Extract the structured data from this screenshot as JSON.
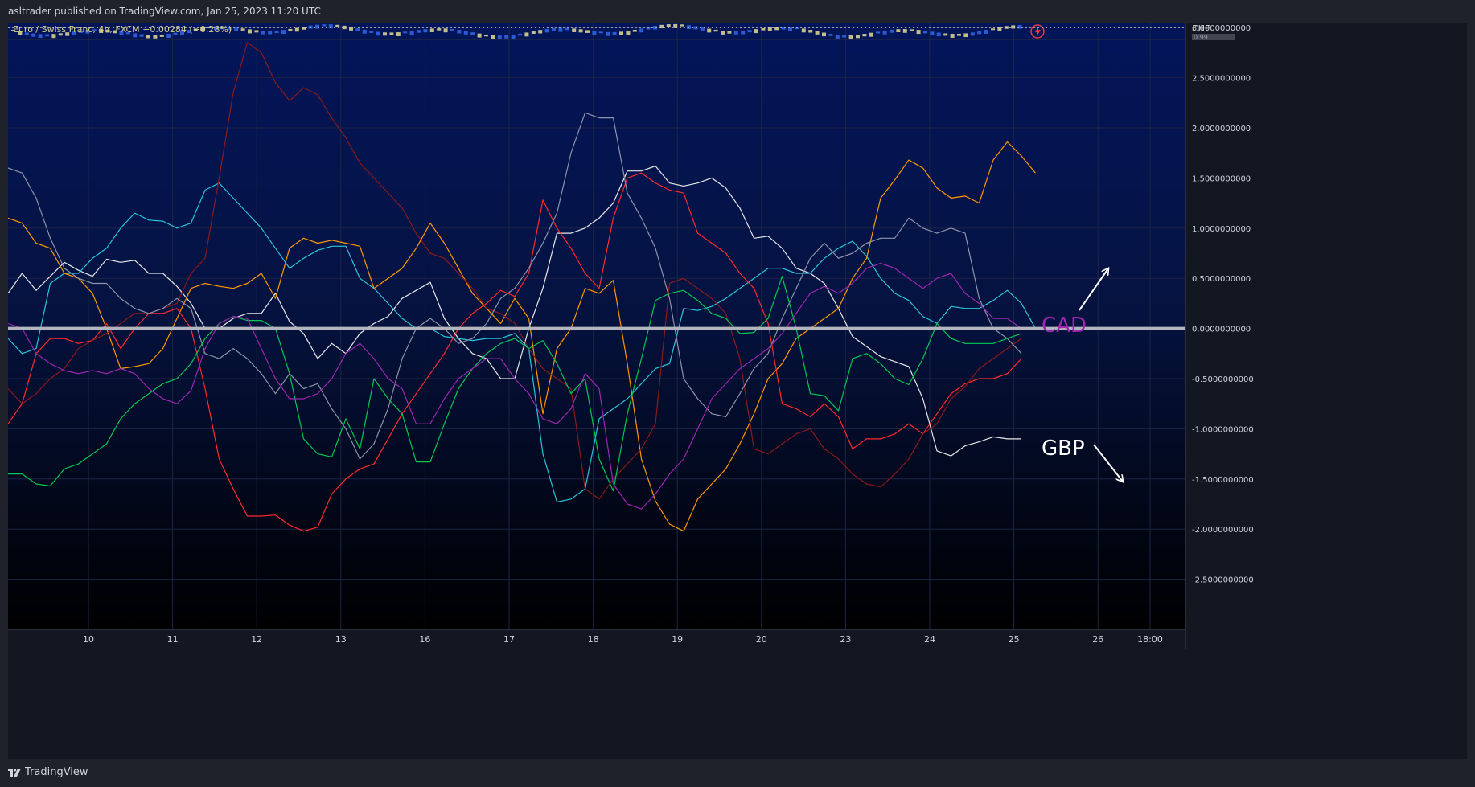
{
  "header": {
    "published": "asltrader published on TradingView.com, Jan 25, 2023 11:20 UTC"
  },
  "footer": {
    "brand": "TradingView"
  },
  "colors": {
    "background_top": "#03155a",
    "background_bottom": "#000000",
    "grid": "#1d2545",
    "axis_text": "#d1d4dc",
    "zero_line": "#b2b5be",
    "price_up": "#d8cf8f",
    "price_down": "#2f63e0"
  },
  "chart_data": {
    "type": "line",
    "symbol_legend": "Euro / Swiss Franc, 4h, FXCM  −0.00284 (−0.28%)",
    "currency_label": "CHF",
    "price_label_partial": "0.99",
    "x_ticks": [
      "10",
      "11",
      "12",
      "13",
      "16",
      "17",
      "18",
      "19",
      "20",
      "23",
      "24",
      "25",
      "26",
      "18:00"
    ],
    "ylim": [
      -3.0,
      3.05
    ],
    "y_ticks": [
      "3.0000000000",
      "2.5000000000",
      "2.0000000000",
      "1.5000000000",
      "1.0000000000",
      "0.5000000000",
      "0.0000000000",
      "-0.5000000000",
      "-1.0000000000",
      "-1.5000000000",
      "-2.0000000000",
      "-2.5000000000"
    ],
    "zero_line": 0,
    "dotted_line": 3.0,
    "annotations": [
      {
        "text": "CAD",
        "color": "#9c27b0"
      },
      {
        "text": "GBP",
        "color": "#ffffff"
      }
    ],
    "series": [
      {
        "color": "#e8e8e8",
        "values": [
          0.35,
          0.55,
          0.38,
          0.52,
          0.66,
          0.58,
          0.52,
          0.69,
          0.66,
          0.68,
          0.55,
          0.55,
          0.42,
          0.25,
          0.0,
          0.0,
          0.1,
          0.15,
          0.15,
          0.35,
          0.07,
          -0.05,
          -0.3,
          -0.15,
          -0.25,
          -0.05,
          0.05,
          0.12,
          0.3,
          0.38,
          0.46,
          0.1,
          -0.1,
          -0.25,
          -0.3,
          -0.5,
          -0.5,
          0.0,
          0.4,
          0.95,
          0.95,
          1.0,
          1.1,
          1.25,
          1.57,
          1.57,
          1.62,
          1.45,
          1.42,
          1.45,
          1.5,
          1.4,
          1.2,
          0.9,
          0.92,
          0.8,
          0.6,
          0.55,
          0.45,
          0.2,
          -0.08,
          -0.18,
          -0.28,
          -0.33,
          -0.38,
          -0.7,
          -1.22,
          -1.27,
          -1.17,
          -1.13,
          -1.08,
          -1.1,
          -1.1
        ]
      },
      {
        "color": "#26c6da",
        "values": [
          -0.1,
          -0.25,
          -0.2,
          0.45,
          0.55,
          0.55,
          0.7,
          0.8,
          1.0,
          1.15,
          1.08,
          1.07,
          1.0,
          1.05,
          1.38,
          1.45,
          1.3,
          1.15,
          1.0,
          0.8,
          0.6,
          0.7,
          0.78,
          0.82,
          0.82,
          0.5,
          0.4,
          0.25,
          0.1,
          0.0,
          0.0,
          -0.08,
          -0.1,
          -0.12,
          -0.1,
          -0.1,
          -0.05,
          -0.2,
          -1.25,
          -1.73,
          -1.7,
          -1.6,
          -0.9,
          -0.8,
          -0.7,
          -0.55,
          -0.4,
          -0.35,
          0.2,
          0.18,
          0.22,
          0.3,
          0.4,
          0.5,
          0.6,
          0.6,
          0.55,
          0.55,
          0.7,
          0.8,
          0.87,
          0.72,
          0.5,
          0.35,
          0.28,
          0.12,
          0.05,
          0.22,
          0.2,
          0.2,
          0.28,
          0.38,
          0.25,
          0.0
        ]
      },
      {
        "color": "#ff9800",
        "values": [
          1.1,
          1.05,
          0.85,
          0.8,
          0.55,
          0.5,
          0.35,
          0.0,
          -0.4,
          -0.38,
          -0.35,
          -0.2,
          0.1,
          0.4,
          0.45,
          0.42,
          0.4,
          0.45,
          0.55,
          0.3,
          0.8,
          0.9,
          0.85,
          0.88,
          0.85,
          0.82,
          0.4,
          0.5,
          0.6,
          0.8,
          1.05,
          0.85,
          0.6,
          0.35,
          0.2,
          0.05,
          0.3,
          0.1,
          -0.85,
          -0.2,
          0.0,
          0.4,
          0.35,
          0.48,
          -0.35,
          -1.3,
          -1.72,
          -1.95,
          -2.02,
          -1.7,
          -1.55,
          -1.4,
          -1.15,
          -0.85,
          -0.5,
          -0.35,
          -0.1,
          0.0,
          0.1,
          0.2,
          0.5,
          0.7,
          1.3,
          1.48,
          1.68,
          1.6,
          1.4,
          1.3,
          1.32,
          1.25,
          1.68,
          1.86,
          1.72,
          1.55
        ]
      },
      {
        "color": "#ff2a2a",
        "values": [
          -0.95,
          -0.75,
          -0.25,
          -0.1,
          -0.1,
          -0.15,
          -0.12,
          0.05,
          -0.2,
          0.0,
          0.15,
          0.15,
          0.2,
          0.0,
          -0.6,
          -1.3,
          -1.6,
          -1.87,
          -1.87,
          -1.86,
          -1.96,
          -2.02,
          -1.98,
          -1.65,
          -1.5,
          -1.4,
          -1.35,
          -1.1,
          -0.85,
          -0.65,
          -0.45,
          -0.25,
          0.0,
          0.15,
          0.25,
          0.38,
          0.32,
          0.55,
          1.28,
          1.0,
          0.8,
          0.55,
          0.4,
          1.1,
          1.5,
          1.55,
          1.45,
          1.38,
          1.35,
          0.95,
          0.85,
          0.75,
          0.55,
          0.4,
          0.05,
          -0.75,
          -0.8,
          -0.88,
          -0.75,
          -0.88,
          -1.2,
          -1.1,
          -1.1,
          -1.05,
          -0.95,
          -1.05,
          -0.85,
          -0.65,
          -0.55,
          -0.5,
          -0.5,
          -0.45,
          -0.3
        ]
      },
      {
        "color": "#8b1a1a",
        "values": [
          -0.6,
          -0.75,
          -0.65,
          -0.5,
          -0.4,
          -0.2,
          -0.12,
          -0.05,
          0.05,
          0.15,
          0.15,
          0.2,
          0.25,
          0.55,
          0.7,
          1.5,
          2.35,
          2.85,
          2.75,
          2.45,
          2.27,
          2.4,
          2.33,
          2.1,
          1.9,
          1.65,
          1.5,
          1.35,
          1.2,
          0.95,
          0.75,
          0.7,
          0.55,
          0.4,
          0.2,
          0.15,
          0.05,
          -0.2,
          -0.4,
          -0.5,
          -0.6,
          -1.6,
          -1.7,
          -1.5,
          -1.35,
          -1.2,
          -0.95,
          0.45,
          0.5,
          0.4,
          0.3,
          0.15,
          -0.3,
          -1.2,
          -1.25,
          -1.15,
          -1.05,
          -1.0,
          -1.2,
          -1.3,
          -1.45,
          -1.55,
          -1.58,
          -1.45,
          -1.3,
          -1.05,
          -0.95,
          -0.7,
          -0.58,
          -0.4,
          -0.3,
          -0.2,
          -0.1
        ]
      },
      {
        "color": "#8d93a8",
        "values": [
          1.6,
          1.55,
          1.3,
          0.9,
          0.6,
          0.5,
          0.45,
          0.45,
          0.3,
          0.2,
          0.15,
          0.2,
          0.3,
          0.2,
          -0.25,
          -0.3,
          -0.2,
          -0.3,
          -0.45,
          -0.65,
          -0.45,
          -0.6,
          -0.55,
          -0.8,
          -1.0,
          -1.3,
          -1.15,
          -0.8,
          -0.3,
          0.0,
          0.1,
          0.0,
          -0.15,
          -0.1,
          0.05,
          0.3,
          0.4,
          0.6,
          0.85,
          1.15,
          1.75,
          2.15,
          2.1,
          2.1,
          1.35,
          1.1,
          0.8,
          0.3,
          -0.5,
          -0.7,
          -0.85,
          -0.88,
          -0.65,
          -0.4,
          -0.25,
          0.1,
          0.4,
          0.7,
          0.85,
          0.7,
          0.75,
          0.85,
          0.9,
          0.9,
          1.1,
          1.0,
          0.95,
          1.0,
          0.95,
          0.3,
          0.0,
          -0.1,
          -0.25
        ]
      },
      {
        "color": "#00c853",
        "values": [
          -1.45,
          -1.45,
          -1.55,
          -1.57,
          -1.4,
          -1.35,
          -1.25,
          -1.15,
          -0.9,
          -0.75,
          -0.65,
          -0.55,
          -0.5,
          -0.35,
          -0.1,
          0.05,
          0.12,
          0.08,
          0.08,
          0.0,
          -0.45,
          -1.1,
          -1.25,
          -1.28,
          -0.9,
          -1.2,
          -0.5,
          -0.7,
          -0.85,
          -1.33,
          -1.33,
          -0.95,
          -0.6,
          -0.4,
          -0.25,
          -0.15,
          -0.1,
          -0.2,
          -0.12,
          -0.35,
          -0.65,
          -0.5,
          -1.3,
          -1.62,
          -0.85,
          -0.3,
          0.28,
          0.35,
          0.38,
          0.28,
          0.15,
          0.1,
          -0.05,
          -0.04,
          0.1,
          0.52,
          0.0,
          -0.65,
          -0.67,
          -0.82,
          -0.3,
          -0.25,
          -0.35,
          -0.5,
          -0.56,
          -0.3,
          0.05,
          -0.1,
          -0.15,
          -0.15,
          -0.15,
          -0.1,
          -0.05
        ]
      },
      {
        "color": "#9c27b0",
        "values": [
          0.05,
          0.0,
          -0.25,
          -0.35,
          -0.42,
          -0.45,
          -0.42,
          -0.45,
          -0.4,
          -0.45,
          -0.6,
          -0.7,
          -0.75,
          -0.62,
          -0.2,
          0.05,
          0.12,
          0.1,
          -0.2,
          -0.5,
          -0.7,
          -0.7,
          -0.65,
          -0.5,
          -0.25,
          -0.15,
          -0.3,
          -0.5,
          -0.6,
          -0.95,
          -0.95,
          -0.7,
          -0.5,
          -0.4,
          -0.3,
          -0.3,
          -0.5,
          -0.65,
          -0.9,
          -0.95,
          -0.8,
          -0.45,
          -0.6,
          -1.55,
          -1.75,
          -1.8,
          -1.65,
          -1.45,
          -1.3,
          -1.0,
          -0.7,
          -0.55,
          -0.4,
          -0.3,
          -0.2,
          -0.05,
          0.15,
          0.35,
          0.42,
          0.35,
          0.45,
          0.6,
          0.65,
          0.6,
          0.5,
          0.4,
          0.5,
          0.55,
          0.35,
          0.25,
          0.1,
          0.1,
          0.0
        ]
      }
    ]
  }
}
